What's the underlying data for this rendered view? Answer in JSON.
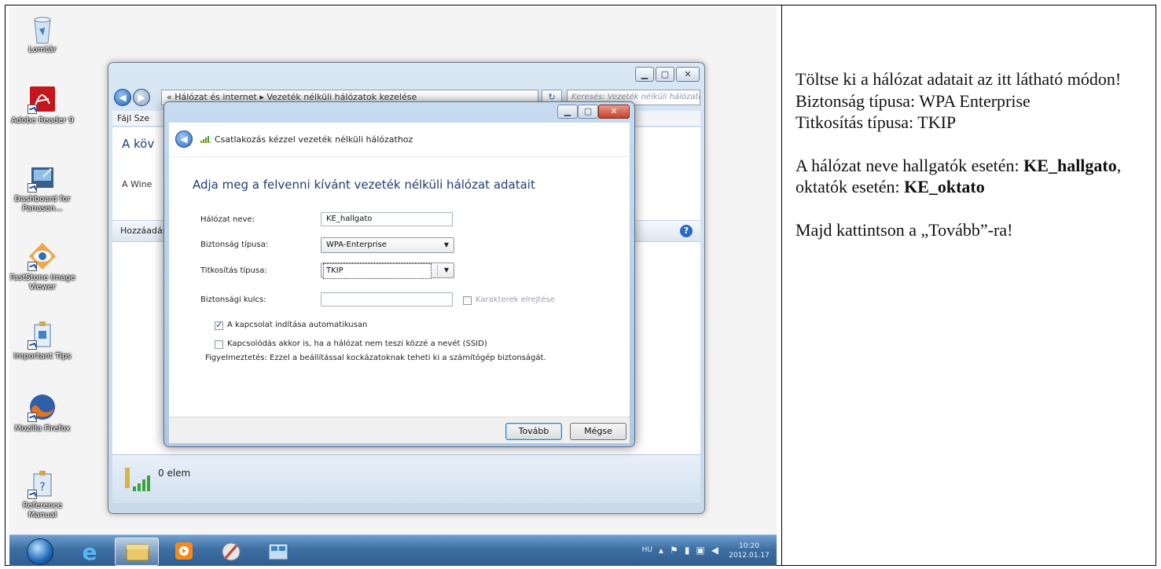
{
  "desktop_icons": [
    {
      "label": "Lomtár",
      "icon": "recycle-bin-icon"
    },
    {
      "label": "Adobe Reader 9",
      "icon": "adobe-reader-icon"
    },
    {
      "label": "Dashboard for Panason...",
      "icon": "dashboard-icon"
    },
    {
      "label": "FastStone Image Viewer",
      "icon": "faststone-icon"
    },
    {
      "label": "Important Tips",
      "icon": "important-tips-icon"
    },
    {
      "label": "Mozilla Firefox",
      "icon": "firefox-icon"
    },
    {
      "label": "Reference Manual",
      "icon": "reference-manual-icon"
    }
  ],
  "explorer": {
    "address": "« Hálózat és internet ▸ Vezeték nélküli hálózatok kezelése",
    "search_placeholder": "Keresés: Vezeték nélküli hálózatok kez...",
    "menu": "Fájl  Sze",
    "content_heading": "A köv",
    "content_sub": "A Wine",
    "toolbar_label": "Hozzáadás",
    "status_count": "0 elem",
    "window_controls": [
      "▁",
      "▢",
      "✕"
    ]
  },
  "dialog": {
    "title": "Csatlakozás kézzel vezeték nélküli hálózathoz",
    "heading": "Adja meg a felvenni kívánt vezeték nélküli hálózat adatait",
    "network_name_label": "Hálózat neve:",
    "network_name_value": "KE_hallgato",
    "security_type_label": "Biztonság típusa:",
    "security_type_value": "WPA-Enterprise",
    "encryption_type_label": "Titkosítás típusa:",
    "encryption_type_value": "TKIP",
    "security_key_label": "Biztonsági kulcs:",
    "security_key_value": "",
    "hide_chars_label": "Karakterek elrejtése",
    "auto_start_label": "A kapcsolat indítása automatikusan",
    "auto_start_checked": true,
    "connect_hidden_label": "Kapcsolódás akkor is, ha a hálózat nem teszi közzé a nevét (SSID)",
    "connect_hidden_checked": false,
    "warning": "Figyelmeztetés: Ezzel a beállítással kockázatoknak teheti ki a számítógép biztonságát.",
    "next_button": "Tovább",
    "cancel_button": "Mégse"
  },
  "taskbar": {
    "language": "HU",
    "time": "10:20",
    "date": "2012.01.17"
  },
  "instructions": {
    "line1": "Töltse ki a hálózat adatait az itt látható módon!",
    "line2": "Biztonság típusa: WPA Enterprise",
    "line3": "Titkosítás típusa: TKIP",
    "line4_prefix": " A hálózat neve hallgatók esetén: ",
    "line4_student": "KE_hallgato",
    "line4_mid": ", oktatók esetén: ",
    "line4_teacher": "KE_oktato",
    "line5": "Majd kattintson a „Tovább”-ra!"
  }
}
